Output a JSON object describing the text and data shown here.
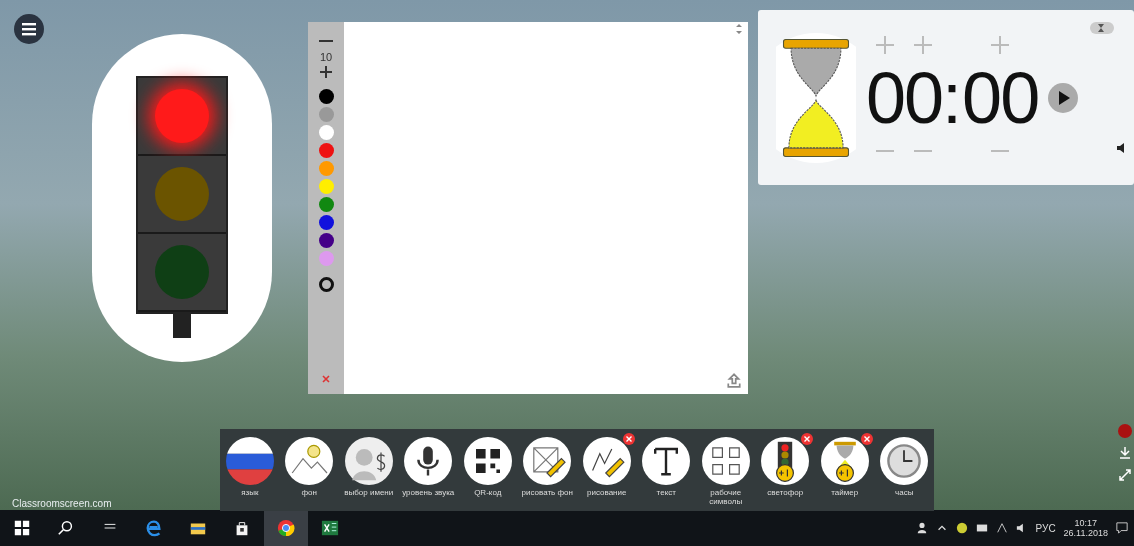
{
  "traffic_light": {
    "lights": [
      {
        "kind": "red",
        "on": true
      },
      {
        "kind": "yellow",
        "on": false
      },
      {
        "kind": "green",
        "on": false
      }
    ]
  },
  "drawing": {
    "pen_size": "10",
    "colors": [
      {
        "color": "#000000"
      },
      {
        "color": "#999999"
      },
      {
        "color": "#ffffff"
      },
      {
        "color": "#ee1111"
      },
      {
        "color": "#ff9900"
      },
      {
        "color": "#ffee00"
      },
      {
        "color": "#118811"
      },
      {
        "color": "#1111dd"
      },
      {
        "color": "#440088"
      },
      {
        "color": "#dd99ee"
      }
    ]
  },
  "timer": {
    "minutes": "00",
    "separator": ":",
    "seconds": "00"
  },
  "toolbar": [
    {
      "kind": "flag",
      "label": "язык",
      "active": false
    },
    {
      "kind": "background",
      "label": "фон",
      "active": false
    },
    {
      "kind": "name",
      "label": "выбор имени",
      "active": false
    },
    {
      "kind": "mic",
      "label": "уровень звука",
      "active": false
    },
    {
      "kind": "qr",
      "label": "QR-код",
      "active": false
    },
    {
      "kind": "sketch",
      "label": "рисовать фон",
      "active": false
    },
    {
      "kind": "draw",
      "label": "рисование",
      "active": true
    },
    {
      "kind": "text",
      "label": "текст",
      "active": false
    },
    {
      "kind": "symbols",
      "label": "рабочие символы",
      "active": false
    },
    {
      "kind": "traffic",
      "label": "светофор",
      "active": true
    },
    {
      "kind": "timer",
      "label": "таймер",
      "active": true
    },
    {
      "kind": "clock",
      "label": "часы",
      "active": false
    }
  ],
  "brand": "Classroomscreen.com",
  "taskbar": {
    "apps": [
      {
        "kind": "start"
      },
      {
        "kind": "search"
      },
      {
        "kind": "taskview"
      },
      {
        "kind": "edge"
      },
      {
        "kind": "files"
      },
      {
        "kind": "store"
      },
      {
        "kind": "chrome"
      },
      {
        "kind": "excel"
      }
    ],
    "language": "РУС",
    "time": "10:17",
    "date": "26.11.2018"
  }
}
